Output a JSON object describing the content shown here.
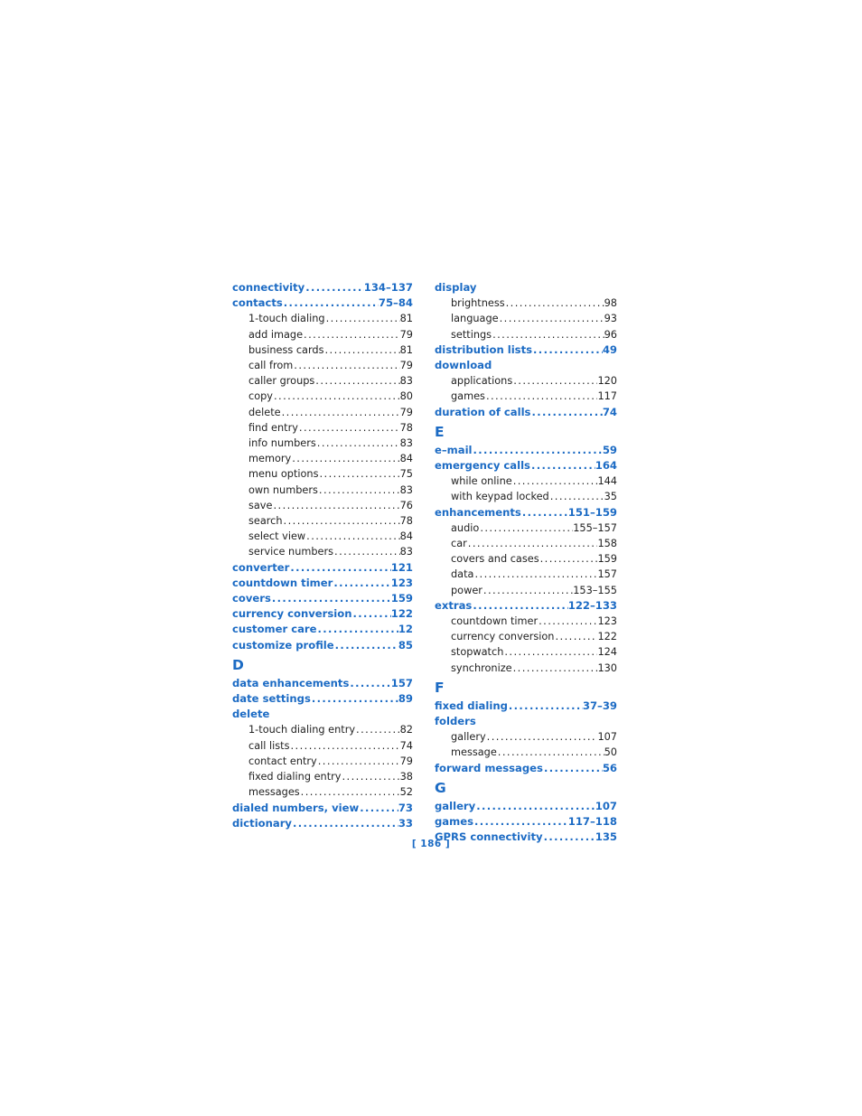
{
  "document": {
    "type": "index",
    "page_label": "[ 186 ]",
    "accent_color": "#1c6bc4",
    "text_color": "#222222"
  },
  "columns": [
    {
      "name": "left-column",
      "blocks": [
        {
          "kind": "entries",
          "entries": [
            {
              "level": 0,
              "label": "connectivity",
              "page": "134–137"
            },
            {
              "level": 0,
              "label": "contacts",
              "page": "75–84"
            },
            {
              "level": 1,
              "label": "1-touch dialing",
              "page": "81"
            },
            {
              "level": 1,
              "label": "add image",
              "page": "79"
            },
            {
              "level": 1,
              "label": "business cards",
              "page": "81"
            },
            {
              "level": 1,
              "label": "call from",
              "page": "79"
            },
            {
              "level": 1,
              "label": "caller groups",
              "page": "83"
            },
            {
              "level": 1,
              "label": "copy",
              "page": "80"
            },
            {
              "level": 1,
              "label": "delete",
              "page": "79"
            },
            {
              "level": 1,
              "label": "find entry",
              "page": "78"
            },
            {
              "level": 1,
              "label": "info numbers",
              "page": "83"
            },
            {
              "level": 1,
              "label": "memory",
              "page": "84"
            },
            {
              "level": 1,
              "label": "menu options",
              "page": "75"
            },
            {
              "level": 1,
              "label": "own numbers",
              "page": "83"
            },
            {
              "level": 1,
              "label": "save",
              "page": "76"
            },
            {
              "level": 1,
              "label": "search",
              "page": "78"
            },
            {
              "level": 1,
              "label": "select view",
              "page": "84"
            },
            {
              "level": 1,
              "label": "service numbers",
              "page": "83"
            },
            {
              "level": 0,
              "label": "converter",
              "page": "121"
            },
            {
              "level": 0,
              "label": "countdown timer",
              "page": "123"
            },
            {
              "level": 0,
              "label": "covers",
              "page": "159"
            },
            {
              "level": 0,
              "label": "currency conversion",
              "page": "122"
            },
            {
              "level": 0,
              "label": "customer care",
              "page": "12"
            },
            {
              "level": 0,
              "label": "customize profile",
              "page": "85"
            }
          ]
        },
        {
          "kind": "letter",
          "letter": "D"
        },
        {
          "kind": "entries",
          "entries": [
            {
              "level": 0,
              "label": "data enhancements",
              "page": "157"
            },
            {
              "level": 0,
              "label": "date settings",
              "page": "89"
            },
            {
              "level": 0,
              "label": "delete",
              "page": ""
            },
            {
              "level": 1,
              "label": "1-touch dialing entry",
              "page": "82"
            },
            {
              "level": 1,
              "label": "call lists",
              "page": "74"
            },
            {
              "level": 1,
              "label": "contact entry",
              "page": "79"
            },
            {
              "level": 1,
              "label": "fixed dialing entry",
              "page": "38"
            },
            {
              "level": 1,
              "label": "messages",
              "page": "52"
            },
            {
              "level": 0,
              "label": "dialed numbers, view",
              "page": "73"
            },
            {
              "level": 0,
              "label": "dictionary",
              "page": "33"
            }
          ]
        }
      ]
    },
    {
      "name": "right-column",
      "blocks": [
        {
          "kind": "entries",
          "entries": [
            {
              "level": 0,
              "label": "display",
              "page": ""
            },
            {
              "level": 1,
              "label": "brightness",
              "page": "98"
            },
            {
              "level": 1,
              "label": "language",
              "page": "93"
            },
            {
              "level": 1,
              "label": "settings",
              "page": "96"
            },
            {
              "level": 0,
              "label": "distribution lists",
              "page": "49"
            },
            {
              "level": 0,
              "label": "download",
              "page": ""
            },
            {
              "level": 1,
              "label": "applications",
              "page": "120"
            },
            {
              "level": 1,
              "label": "games",
              "page": "117"
            },
            {
              "level": 0,
              "label": "duration of calls",
              "page": "74"
            }
          ]
        },
        {
          "kind": "letter",
          "letter": "E"
        },
        {
          "kind": "entries",
          "entries": [
            {
              "level": 0,
              "label": "e–mail",
              "page": "59"
            },
            {
              "level": 0,
              "label": "emergency calls",
              "page": "164"
            },
            {
              "level": 1,
              "label": "while online",
              "page": "144"
            },
            {
              "level": 1,
              "label": "with keypad locked",
              "page": "35"
            },
            {
              "level": 0,
              "label": "enhancements",
              "page": "151–159"
            },
            {
              "level": 1,
              "label": "audio",
              "page": "155–157"
            },
            {
              "level": 1,
              "label": "car",
              "page": "158"
            },
            {
              "level": 1,
              "label": "covers and cases",
              "page": "159"
            },
            {
              "level": 1,
              "label": "data",
              "page": "157"
            },
            {
              "level": 1,
              "label": "power",
              "page": "153–155"
            },
            {
              "level": 0,
              "label": "extras",
              "page": "122–133"
            },
            {
              "level": 1,
              "label": "countdown timer",
              "page": "123"
            },
            {
              "level": 1,
              "label": "currency conversion",
              "page": "122"
            },
            {
              "level": 1,
              "label": "stopwatch",
              "page": "124"
            },
            {
              "level": 1,
              "label": "synchronize",
              "page": "130"
            }
          ]
        },
        {
          "kind": "letter",
          "letter": "F"
        },
        {
          "kind": "entries",
          "entries": [
            {
              "level": 0,
              "label": "fixed dialing",
              "page": "37–39"
            },
            {
              "level": 0,
              "label": "folders",
              "page": ""
            },
            {
              "level": 1,
              "label": "gallery",
              "page": "107"
            },
            {
              "level": 1,
              "label": "message",
              "page": "50"
            },
            {
              "level": 0,
              "label": "forward messages",
              "page": "56"
            }
          ]
        },
        {
          "kind": "letter",
          "letter": "G"
        },
        {
          "kind": "entries",
          "entries": [
            {
              "level": 0,
              "label": "gallery",
              "page": "107"
            },
            {
              "level": 0,
              "label": "games",
              "page": "117–118"
            },
            {
              "level": 0,
              "label": "GPRS connectivity",
              "page": "135"
            }
          ]
        }
      ]
    }
  ]
}
